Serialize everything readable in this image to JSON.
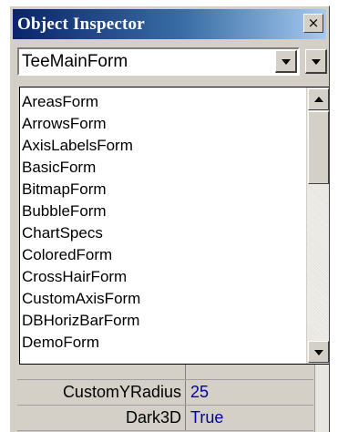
{
  "window": {
    "title": "Object Inspector",
    "close_glyph": "×"
  },
  "combo": {
    "value": "TeeMainForm"
  },
  "dropdown": {
    "items": [
      "AreasForm",
      "ArrowsForm",
      "AxisLabelsForm",
      "BasicForm",
      "BitmapForm",
      "BubbleForm",
      "ChartSpecs",
      "ColoredForm",
      "CrossHairForm",
      "CustomAxisForm",
      "DBHorizBarForm",
      "DemoForm"
    ]
  },
  "grid": {
    "rows": [
      {
        "name": "CustomYRadius",
        "value": "25"
      },
      {
        "name": "Dark3D",
        "value": "True"
      }
    ]
  },
  "icons": {
    "close": "close-icon",
    "combo_dropdown": "chevron-down-icon",
    "scroll_up": "arrow-up-icon",
    "scroll_down": "arrow-down-icon"
  }
}
